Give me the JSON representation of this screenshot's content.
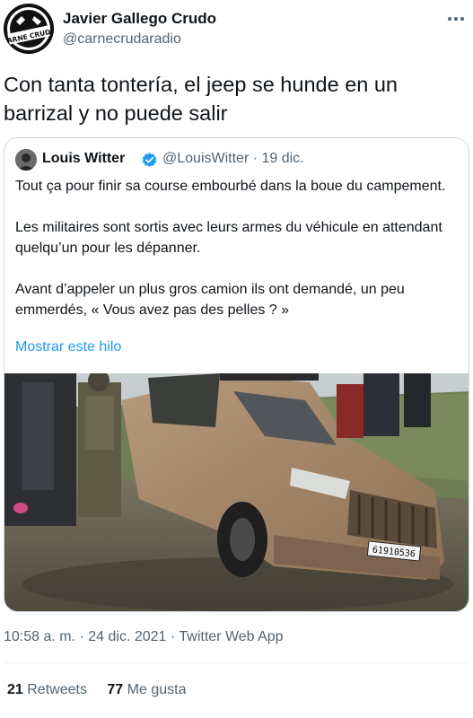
{
  "tweet": {
    "author": {
      "display_name": "Javier Gallego Crudo",
      "handle": "@carnecrudaradio",
      "avatar_text": "CARNE CRUDA"
    },
    "text": "Con tanta tontería, el jeep se hunde en un barrizal y no puede salir",
    "quoted": {
      "author_name": "Louis Witter",
      "handle_date": "@LouisWitter · 19 dic.",
      "paragraphs": [
        "Tout ça pour finir sa course embourbé dans la boue du campement.",
        "Les militaires sont sortis avec leurs armes du véhicule en attendant quelqu’un pour les dépanner.",
        "Avant d’appeler un plus gros camion ils ont demandé, un peu emmerdés, « Vous avez pas des pelles ? »"
      ],
      "show_thread": "Mostrar este hilo",
      "media": {
        "plate": "61910536"
      }
    },
    "meta": "10:58 a. m. · 24 dic. 2021 · Twitter Web App",
    "stats": {
      "retweets_count": "21",
      "retweets_label": "Retweets",
      "likes_count": "77",
      "likes_label": "Me gusta"
    }
  },
  "colors": {
    "text": "#0f1419",
    "secondary": "#536471",
    "link": "#1d9bf0",
    "border": "#cfd9de"
  },
  "icons": [
    "more-icon",
    "verified-badge-icon"
  ]
}
